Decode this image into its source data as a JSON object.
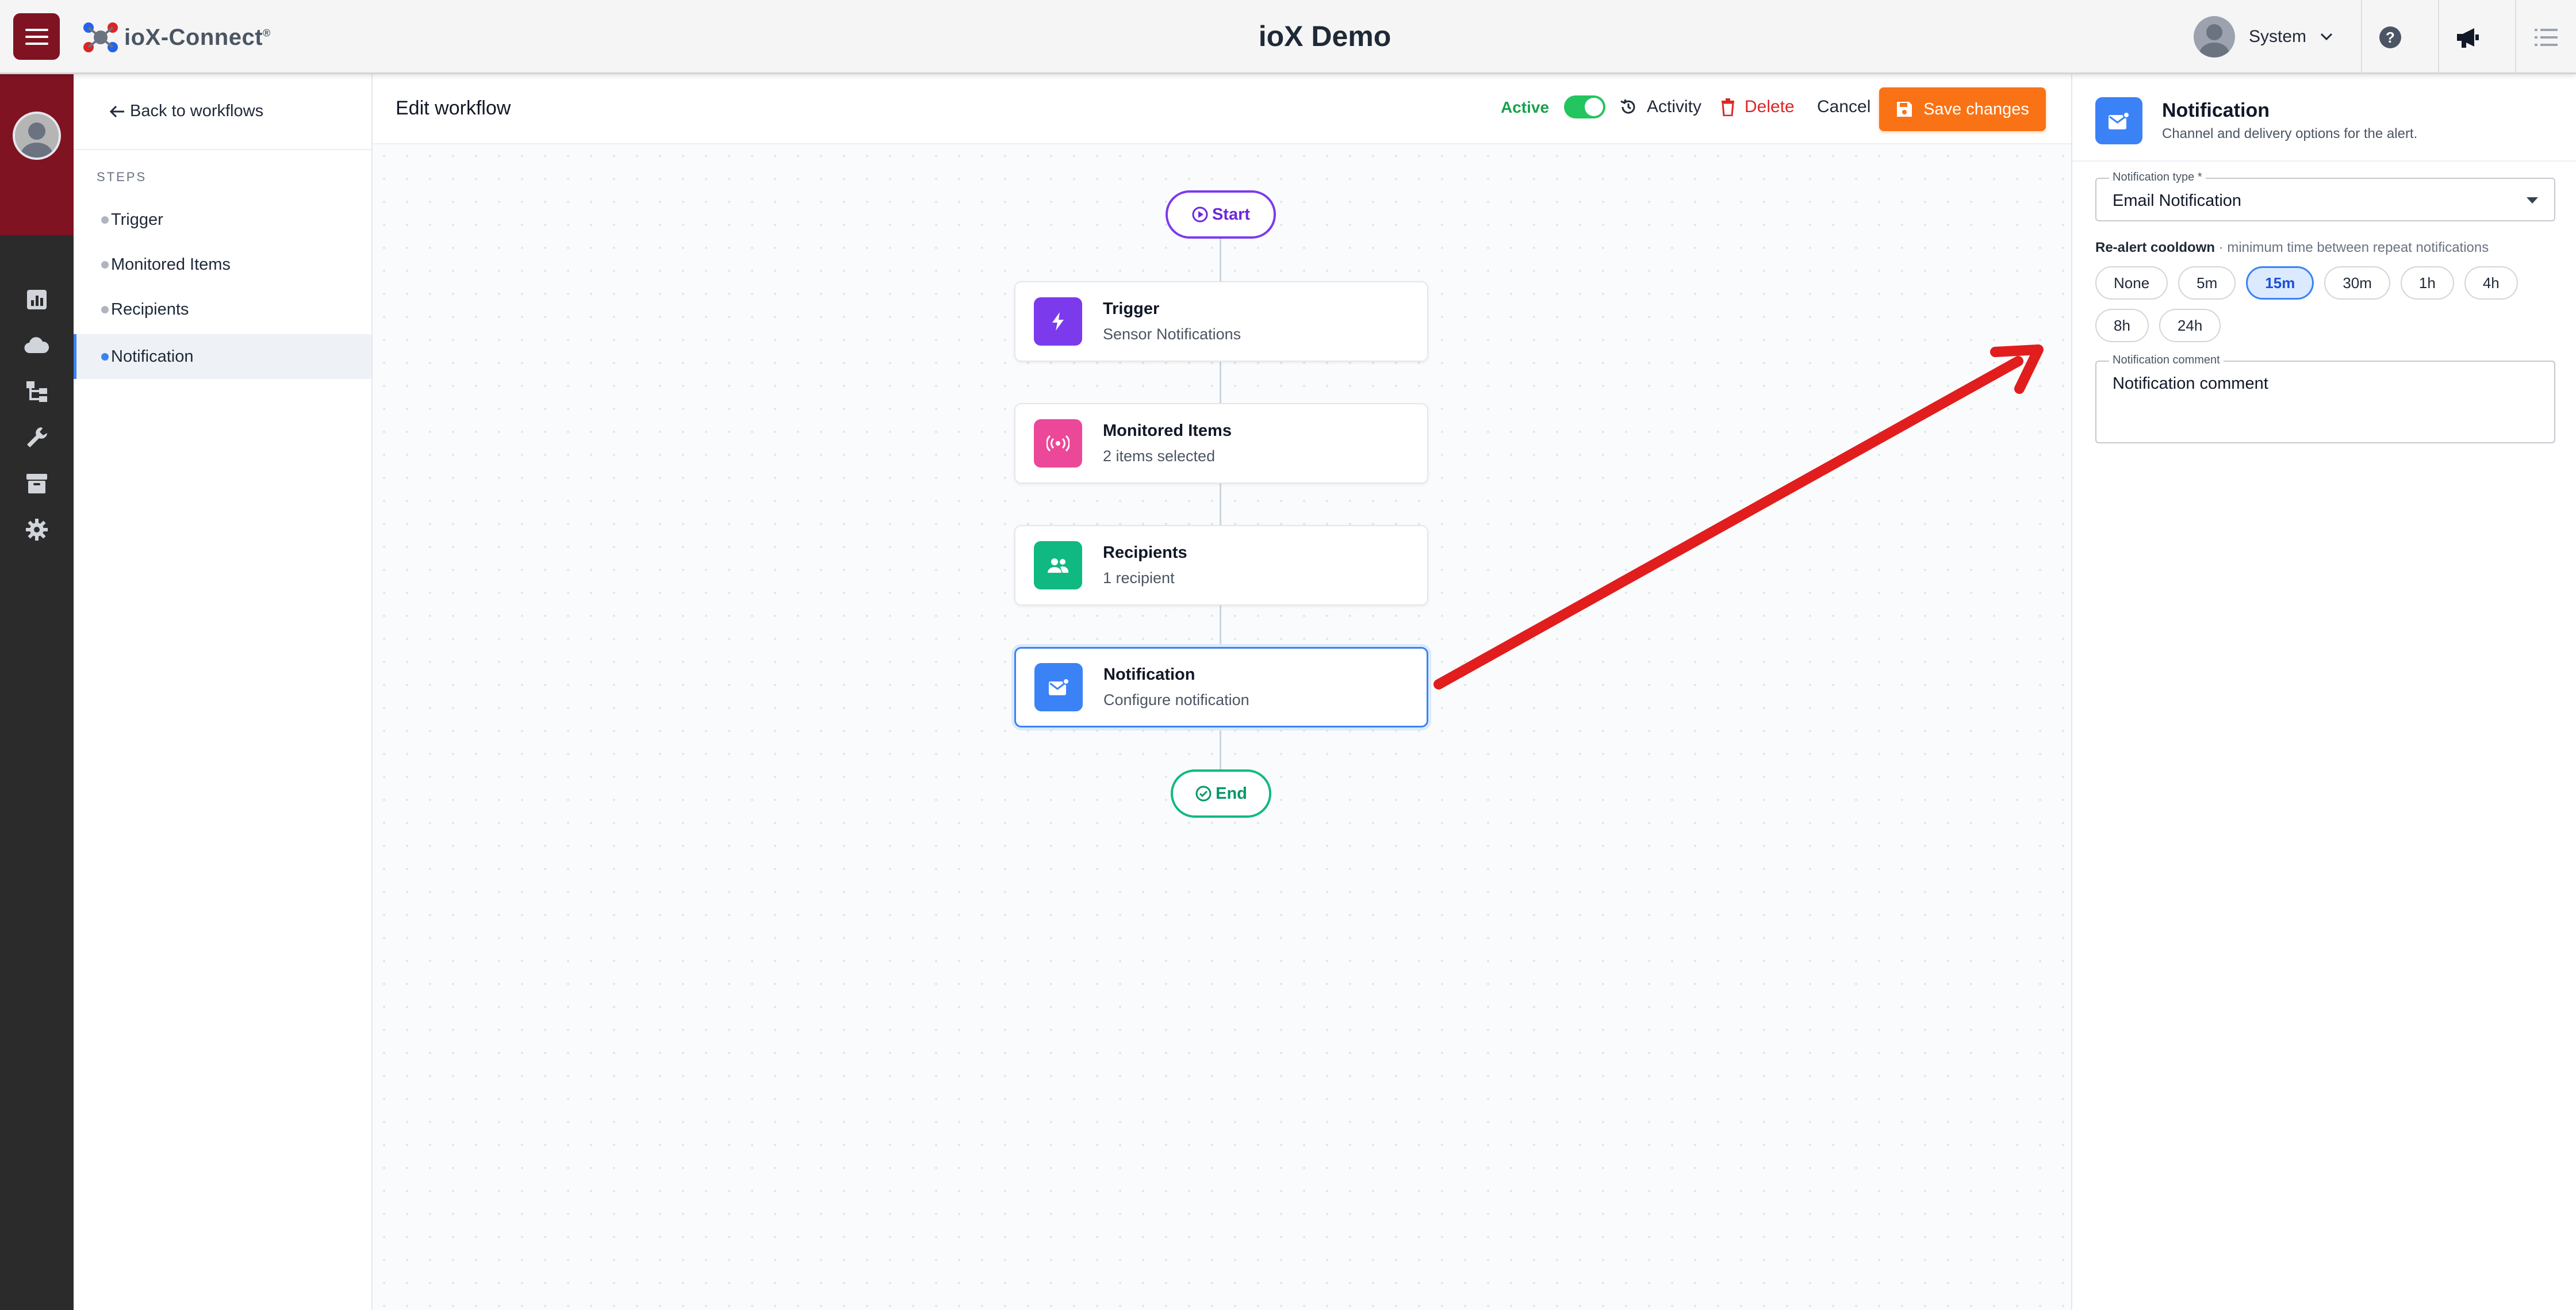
{
  "topbar": {
    "logo_text": "ioX-Connect",
    "logo_mark": "®",
    "app_title": "ioX Demo",
    "user_name": "System",
    "icons": [
      "menu-icon",
      "help-icon",
      "megaphone-icon",
      "list-icon"
    ]
  },
  "rail": {
    "icons": [
      "chart-icon",
      "cloud-icon",
      "hierarchy-icon",
      "wrench-icon",
      "archive-icon",
      "gear-icon"
    ]
  },
  "steps": {
    "back_label": "Back to workflows",
    "heading": "STEPS",
    "items": [
      {
        "label": "Trigger"
      },
      {
        "label": "Monitored Items"
      },
      {
        "label": "Recipients"
      },
      {
        "label": "Notification",
        "active": true
      }
    ]
  },
  "editor": {
    "title": "Edit workflow",
    "active_label": "Active",
    "active_on": true,
    "activity_label": "Activity",
    "delete_label": "Delete",
    "cancel_label": "Cancel",
    "save_label": "Save changes"
  },
  "flow": {
    "start_label": "Start",
    "end_label": "End",
    "nodes": [
      {
        "title": "Trigger",
        "subtitle": "Sensor Notifications",
        "icon": "lightning-icon",
        "color": "#7c3aed"
      },
      {
        "title": "Monitored Items",
        "subtitle": "2 items selected",
        "icon": "broadcast-icon",
        "color": "#ec4899"
      },
      {
        "title": "Recipients",
        "subtitle": "1 recipient",
        "icon": "users-icon",
        "color": "#10b981"
      },
      {
        "title": "Notification",
        "subtitle": "Configure notification",
        "icon": "mail-icon",
        "color": "#3b82f6",
        "selected": true
      }
    ]
  },
  "panel": {
    "title": "Notification",
    "subtitle": "Channel and delivery options for the alert.",
    "type_label": "Notification type *",
    "type_value": "Email Notification",
    "cooldown_title": "Re-alert cooldown",
    "cooldown_hint": " · minimum time between repeat notifications",
    "cooldown_options": [
      "None",
      "5m",
      "15m",
      "30m",
      "1h",
      "4h",
      "8h",
      "24h"
    ],
    "cooldown_selected": "15m",
    "comment_label": "Notification comment",
    "comment_value": "Notification comment"
  },
  "colors": {
    "brand": "#7f1321",
    "accent": "#3b82f6",
    "save": "#f97316",
    "active": "#22c55e",
    "delete": "#dc2626",
    "annotation_arrow": "#e11d1d"
  }
}
